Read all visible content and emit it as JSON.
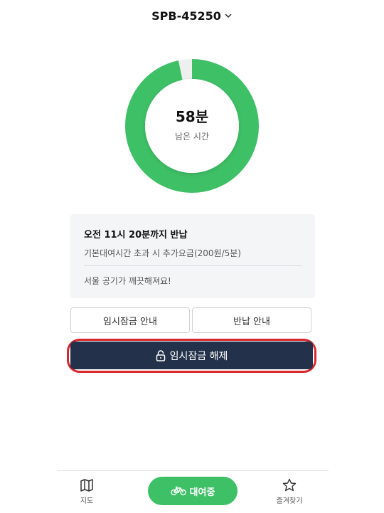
{
  "header": {
    "bike_id": "SPB-45250"
  },
  "timer": {
    "minutes_text": "58분",
    "label": "남은 시간",
    "remaining_fraction": 0.967
  },
  "info_card": {
    "return_time": "오전 11시 20분까지 반납",
    "fee_note": "기본대여시간 초과 시 추가요금(200원/5분)",
    "eco_message": "서울 공기가 깨끗해져요!"
  },
  "buttons": {
    "lock_guide": "임시잠금 안내",
    "return_guide": "반납 안내",
    "unlock": "임시잠금 해제"
  },
  "bottom_nav": {
    "map_label": "지도",
    "renting_label": "대여중",
    "favorites_label": "즐겨찾기"
  },
  "colors": {
    "ring": "#3ec066",
    "ring_track": "#eef0f0",
    "unlock_button": "#23324a",
    "highlight": "#d9262c"
  }
}
